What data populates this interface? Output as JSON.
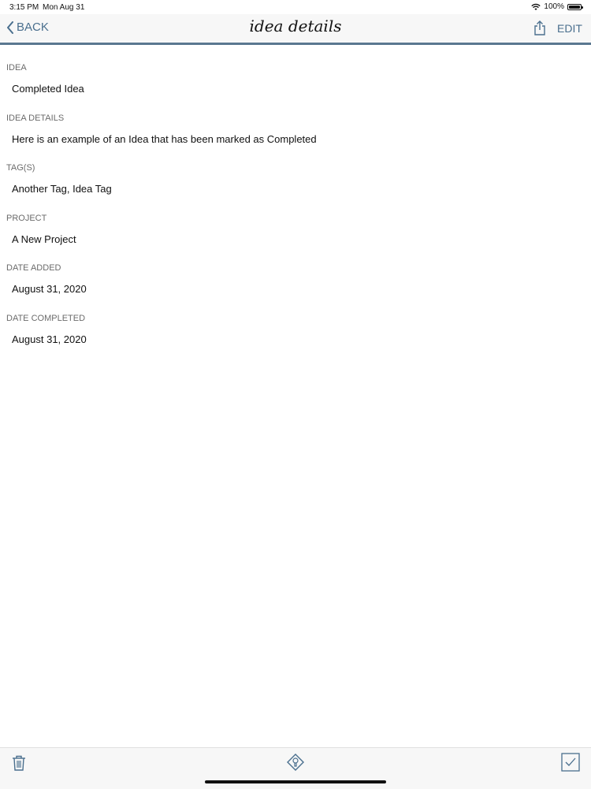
{
  "status": {
    "time": "3:15 PM",
    "date": "Mon Aug 31",
    "battery": "100%"
  },
  "nav": {
    "back_label": "BACK",
    "title": "idea details",
    "edit_label": "EDIT"
  },
  "fields": [
    {
      "label": "IDEA",
      "value": "Completed Idea"
    },
    {
      "label": "IDEA DETAILS",
      "value": "Here is an example of an Idea that has been marked as Completed"
    },
    {
      "label": "TAG(S)",
      "value": "Another Tag, Idea Tag"
    },
    {
      "label": "PROJECT",
      "value": "A New Project"
    },
    {
      "label": "DATE ADDED",
      "value": "August 31, 2020"
    },
    {
      "label": "DATE COMPLETED",
      "value": "August 31, 2020"
    }
  ],
  "toolbar": {
    "icons": [
      "trash-icon",
      "idea-icon",
      "checkbox-icon"
    ]
  },
  "colors": {
    "accent": "#4a6f8e",
    "nav_line": "#5a7890"
  }
}
